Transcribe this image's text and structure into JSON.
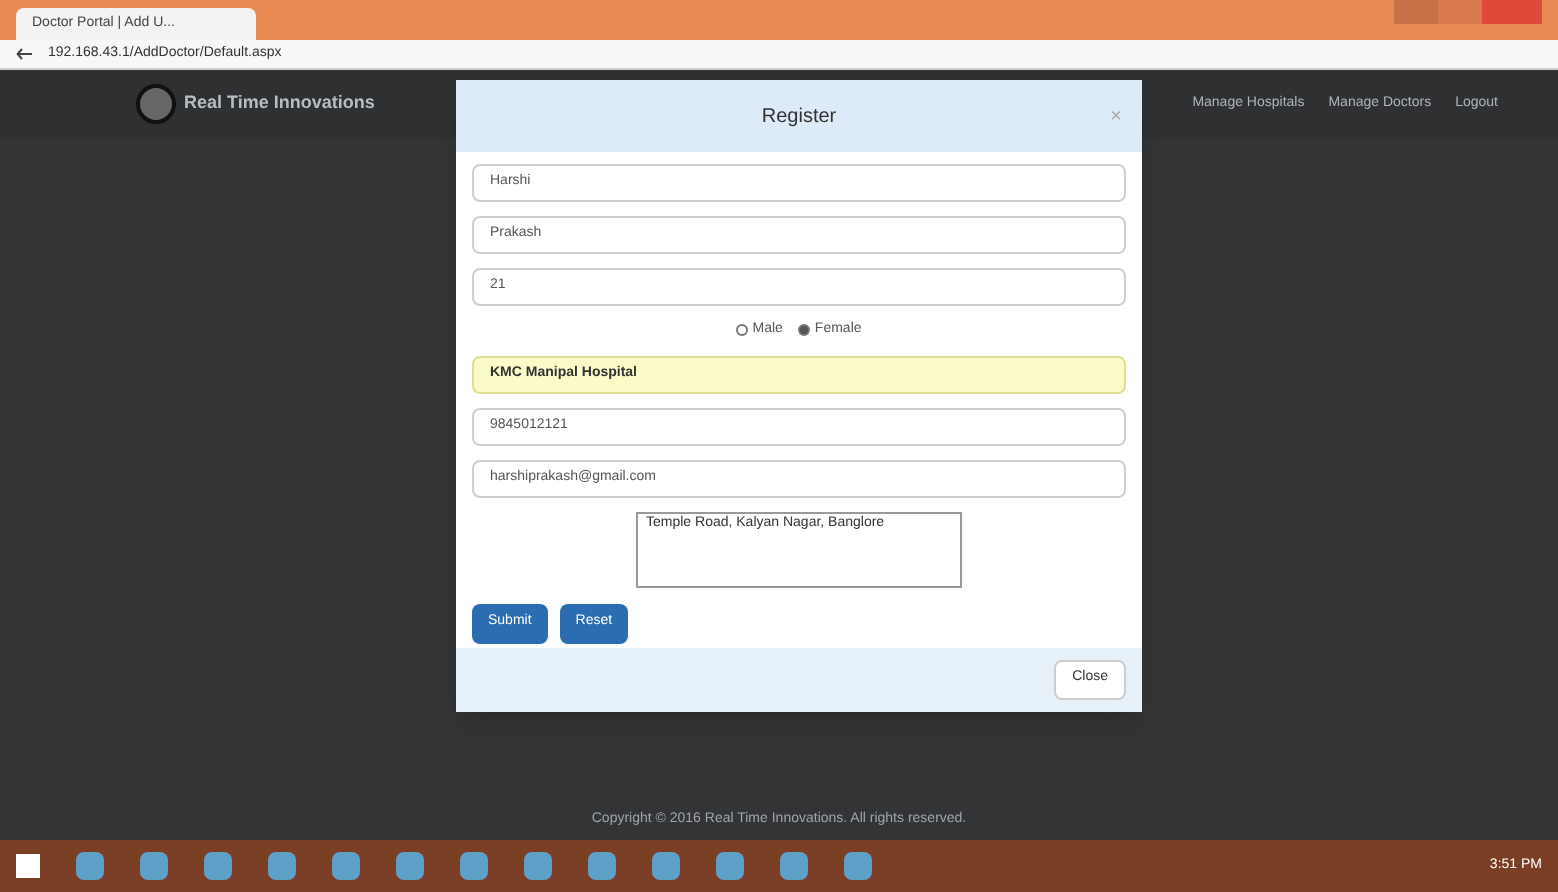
{
  "browser": {
    "tab_title": "Doctor Portal | Add U...",
    "url": "192.168.43.1/AddDoctor/Default.aspx"
  },
  "navbar": {
    "brand": "Real Time Innovations",
    "links": [
      "Manage Hospitals",
      "Manage Doctors",
      "Logout"
    ]
  },
  "modal": {
    "title": "Register",
    "close_symbol": "×",
    "fields": [
      {
        "kind": "input",
        "value": "Harshi"
      },
      {
        "kind": "input",
        "value": "Prakash"
      },
      {
        "kind": "input",
        "value": "21"
      },
      {
        "kind": "radio",
        "options": [
          {
            "label": "Male",
            "selected": false
          },
          {
            "label": "Female",
            "selected": true
          }
        ]
      },
      {
        "kind": "select",
        "value": "KMC Manipal Hospital"
      },
      {
        "kind": "input",
        "value": "9845012121"
      },
      {
        "kind": "input",
        "value": "harshiprakash@gmail.com"
      },
      {
        "kind": "textarea",
        "value": "Temple Road, Kalyan Nagar, Banglore"
      }
    ],
    "buttons": [
      "Submit",
      "Reset"
    ],
    "footer_button": "Close"
  },
  "footer": {
    "text": "Copyright © 2016 Real Time Innovations. All rights reserved."
  },
  "taskbar": {
    "time": "3:51 PM"
  }
}
